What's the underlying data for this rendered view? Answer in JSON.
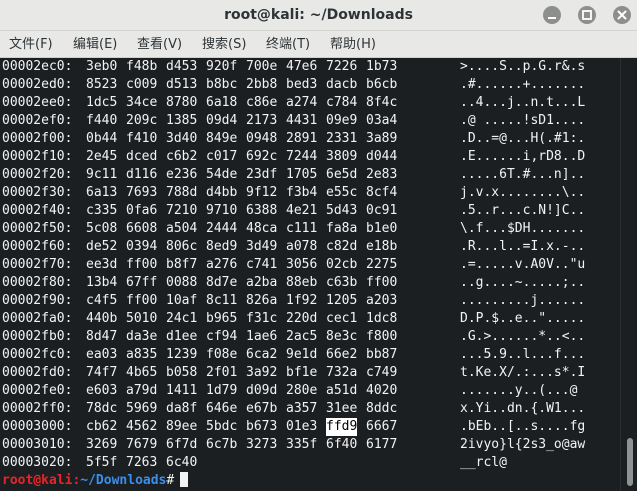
{
  "window": {
    "title": "root@kali: ~/Downloads"
  },
  "menu": [
    "文件(F)",
    "编辑(E)",
    "查看(V)",
    "搜索(S)",
    "终端(T)",
    "帮助(H)"
  ],
  "hexdump": [
    {
      "offset": "00002ec0:",
      "words": [
        "3eb0",
        "f48b",
        "d453",
        "920f",
        "700e",
        "47e6",
        "7226",
        "1b73"
      ],
      "ascii": ">....S..p.G.r&.s"
    },
    {
      "offset": "00002ed0:",
      "words": [
        "8523",
        "c009",
        "d513",
        "b8bc",
        "2bb8",
        "bed3",
        "dacb",
        "b6cb"
      ],
      "ascii": ".#......+......."
    },
    {
      "offset": "00002ee0:",
      "words": [
        "1dc5",
        "34ce",
        "8780",
        "6a18",
        "c86e",
        "a274",
        "c784",
        "8f4c"
      ],
      "ascii": "..4...j..n.t...L"
    },
    {
      "offset": "00002ef0:",
      "words": [
        "f440",
        "209c",
        "1385",
        "09d4",
        "2173",
        "4431",
        "09e9",
        "03a4"
      ],
      "ascii": ".@ .....!sD1...."
    },
    {
      "offset": "00002f00:",
      "words": [
        "0b44",
        "f410",
        "3d40",
        "849e",
        "0948",
        "2891",
        "2331",
        "3a89"
      ],
      "ascii": ".D..=@...H(.#1:."
    },
    {
      "offset": "00002f10:",
      "words": [
        "2e45",
        "dced",
        "c6b2",
        "c017",
        "692c",
        "7244",
        "3809",
        "d044"
      ],
      "ascii": ".E......i,rD8..D"
    },
    {
      "offset": "00002f20:",
      "words": [
        "9c11",
        "d116",
        "e236",
        "54de",
        "23df",
        "1705",
        "6e5d",
        "2e83"
      ],
      "ascii": ".....6T.#...n].."
    },
    {
      "offset": "00002f30:",
      "words": [
        "6a13",
        "7693",
        "788d",
        "d4bb",
        "9f12",
        "f3b4",
        "e55c",
        "8cf4"
      ],
      "ascii": "j.v.x........\\.."
    },
    {
      "offset": "00002f40:",
      "words": [
        "c335",
        "0fa6",
        "7210",
        "9710",
        "6388",
        "4e21",
        "5d43",
        "0c91"
      ],
      "ascii": ".5..r...c.N!]C.."
    },
    {
      "offset": "00002f50:",
      "words": [
        "5c08",
        "6608",
        "a504",
        "2444",
        "48ca",
        "c111",
        "fa8a",
        "b1e0"
      ],
      "ascii": "\\.f...$DH......."
    },
    {
      "offset": "00002f60:",
      "words": [
        "de52",
        "0394",
        "806c",
        "8ed9",
        "3d49",
        "a078",
        "c82d",
        "e18b"
      ],
      "ascii": ".R...l..=I.x.-.."
    },
    {
      "offset": "00002f70:",
      "words": [
        "ee3d",
        "ff00",
        "b8f7",
        "a276",
        "c741",
        "3056",
        "02cb",
        "2275"
      ],
      "ascii": ".=.....v.A0V..\"u"
    },
    {
      "offset": "00002f80:",
      "words": [
        "13b4",
        "67ff",
        "0088",
        "8d7e",
        "a2ba",
        "88eb",
        "c63b",
        "ff00"
      ],
      "ascii": "..g....~.....;.."
    },
    {
      "offset": "00002f90:",
      "words": [
        "c4f5",
        "ff00",
        "10af",
        "8c11",
        "826a",
        "1f92",
        "1205",
        "a203"
      ],
      "ascii": ".........j......"
    },
    {
      "offset": "00002fa0:",
      "words": [
        "440b",
        "5010",
        "24c1",
        "b965",
        "f31c",
        "220d",
        "cec1",
        "1dc8"
      ],
      "ascii": "D.P.$..e..\"....."
    },
    {
      "offset": "00002fb0:",
      "words": [
        "8d47",
        "da3e",
        "d1ee",
        "cf94",
        "1ae6",
        "2ac5",
        "8e3c",
        "f800"
      ],
      "ascii": ".G.>......*..<.."
    },
    {
      "offset": "00002fc0:",
      "words": [
        "ea03",
        "a835",
        "1239",
        "f08e",
        "6ca2",
        "9e1d",
        "66e2",
        "bb87"
      ],
      "ascii": "...5.9..l...f..."
    },
    {
      "offset": "00002fd0:",
      "words": [
        "74f7",
        "4b65",
        "b058",
        "2f01",
        "3a92",
        "bf1e",
        "732a",
        "c749"
      ],
      "ascii": "t.Ke.X/.:...s*.I"
    },
    {
      "offset": "00002fe0:",
      "words": [
        "e603",
        "a79d",
        "1411",
        "1d79",
        "d09d",
        "280e",
        "a51d",
        "4020"
      ],
      "ascii": ".......y..(...@ "
    },
    {
      "offset": "00002ff0:",
      "words": [
        "78dc",
        "5969",
        "da8f",
        "646e",
        "e67b",
        "a357",
        "31ee",
        "8ddc"
      ],
      "ascii": "x.Yi..dn.{.W1..."
    },
    {
      "offset": "00003000:",
      "words": [
        "cb62",
        "4562",
        "89ee",
        "5bdc",
        "b673",
        "01e3",
        "ffd9",
        "6667"
      ],
      "ascii": ".bEb..[..s....fg",
      "highlight": 6
    },
    {
      "offset": "00003010:",
      "words": [
        "3269",
        "7679",
        "6f7d",
        "6c7b",
        "3273",
        "335f",
        "6f40",
        "6177"
      ],
      "ascii": "2ivyo}l{2s3_o@aw"
    },
    {
      "offset": "00003020:",
      "words": [
        "5f5f",
        "7263",
        "6c40"
      ],
      "ascii": "__rcl@"
    }
  ],
  "prompt": {
    "user": "root@kali",
    "sep": ":",
    "path": "~/Downloads",
    "symbol": "#"
  }
}
